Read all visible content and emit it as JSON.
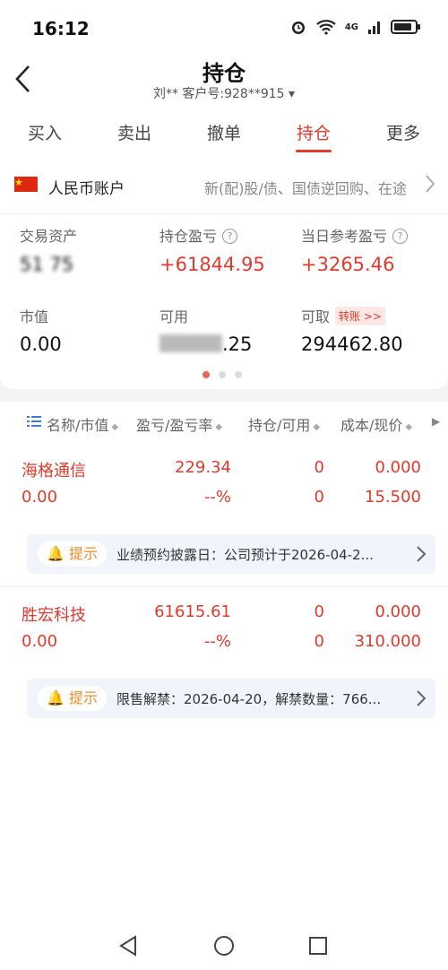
{
  "status": {
    "time": "16:12",
    "network": "4G"
  },
  "header": {
    "title": "持仓",
    "subtitle": "刘**  客户号:928**915 ▾"
  },
  "tabs": [
    {
      "label": "买入"
    },
    {
      "label": "卖出"
    },
    {
      "label": "撤单"
    },
    {
      "label": "持仓",
      "active": true
    },
    {
      "label": "更多"
    }
  ],
  "account": {
    "name": "人民币账户",
    "desc": "新(配)股/债、国债逆回购、在途"
  },
  "stats": {
    "assets_label": "交易资产",
    "assets_value": "51  75",
    "pnl_label": "持仓盈亏",
    "pnl_value": "+61844.95",
    "daily_label": "当日参考盈亏",
    "daily_value": "+3265.46",
    "mv_label": "市值",
    "mv_value": "0.00",
    "avail_label": "可用",
    "avail_value": ".25",
    "withdraw_label": "可取",
    "withdraw_value": "294462.80",
    "transfer_label": "转账 >>"
  },
  "columns": {
    "c1": "名称/市值",
    "c2": "盈亏/盈亏率",
    "c3": "持仓/可用",
    "c4": "成本/现价"
  },
  "positions": [
    {
      "name": "海格通信",
      "mv": "0.00",
      "pnl": "229.34",
      "pnl_rate": "--%",
      "hold": "0",
      "avail": "0",
      "cost": "0.000",
      "price": "15.500",
      "notice_tag": "提示",
      "notice": "业绩预约披露日：公司预计于2026-04-2..."
    },
    {
      "name": "胜宏科技",
      "mv": "0.00",
      "pnl": "61615.61",
      "pnl_rate": "--%",
      "hold": "0",
      "avail": "0",
      "cost": "0.000",
      "price": "310.000",
      "notice_tag": "提示",
      "notice": "限售解禁：2026-04-20，解禁数量：766..."
    }
  ],
  "colors": {
    "accent": "#e23a2c",
    "notice": "#f08a24"
  }
}
